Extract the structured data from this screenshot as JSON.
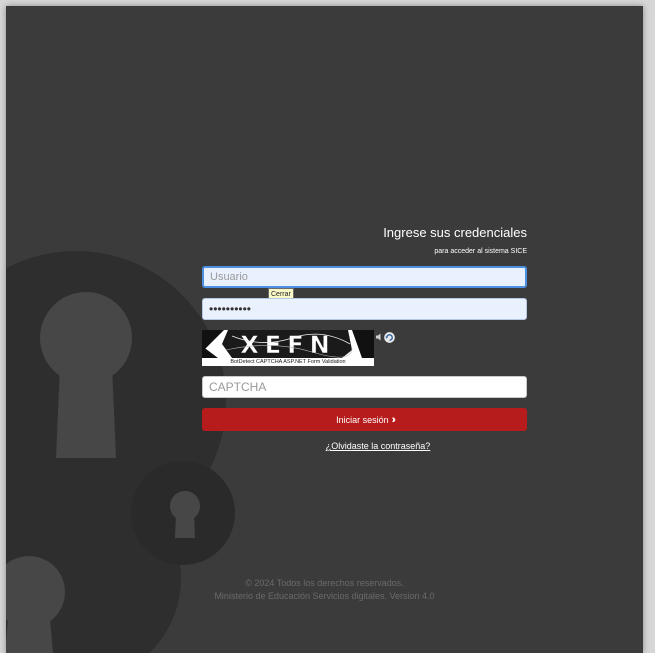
{
  "login": {
    "heading": "Ingrese sus credenciales",
    "subheading": "para acceder al sistema SICE",
    "username_placeholder": "Usuario",
    "username_value": "",
    "password_value": "••••••••••",
    "tooltip": "Cerrar",
    "captcha_code": "XEFN",
    "captcha_caption": "BotDetect CAPTCHA ASP.NET Form Validation",
    "captcha_placeholder": "CAPTCHA",
    "submit_label": "Iniciar sesión",
    "submit_icon": "double-chevron-right-icon",
    "forgot_link": "¿Olvidaste la contraseña?"
  },
  "footer": {
    "line1": "© 2024 Todos los derechos reservados.",
    "line2": "Ministerio de Educación Servicios digitales. Version 4.0"
  },
  "colors": {
    "background": "#3b3b3b",
    "accent": "#b71c1c",
    "focus": "#4d8fe0",
    "deco": "#2c2c2c"
  }
}
